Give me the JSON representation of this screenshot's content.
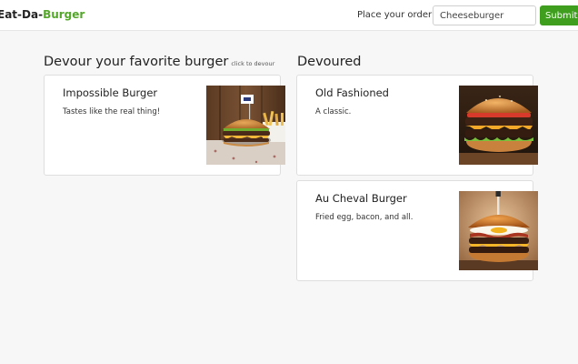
{
  "navbar": {
    "brand_prefix": "Eat-Da-",
    "brand_accent": "Burger",
    "order_label": "Place your order:",
    "order_input_value": "Cheeseburger",
    "submit_label": "Submit"
  },
  "colors": {
    "accent": "#55a72c",
    "button": "#3f9e1e"
  },
  "menu": {
    "heading": "Devour your favorite burger",
    "hint": "click to devour",
    "items": [
      {
        "name": "Impossible Burger",
        "description": "Tastes like the real thing!",
        "image": "burger-photo-flag"
      }
    ]
  },
  "devoured": {
    "heading": "Devoured",
    "items": [
      {
        "name": "Old Fashioned",
        "description": "A classic.",
        "image": "burger-photo-double"
      },
      {
        "name": "Au Cheval Burger",
        "description": "Fried egg, bacon, and all.",
        "image": "burger-photo-egg"
      }
    ]
  }
}
